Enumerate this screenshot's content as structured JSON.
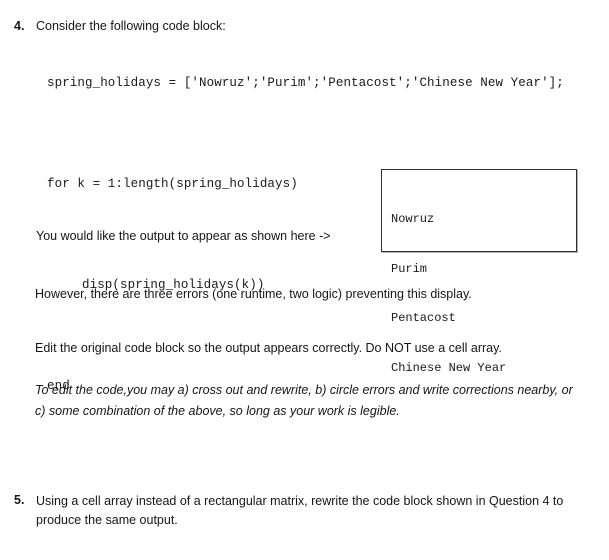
{
  "document": {
    "type": "homework-worksheet",
    "background_color": "#ffffff",
    "text_color": "#161616"
  },
  "question4": {
    "number": "4.",
    "prompt": "Consider the following code block:",
    "code_lines": [
      "spring_holidays = ['Nowruz';'Purim';'Pentacost';'Chinese New Year'];",
      "for k = 1:length(spring_holidays)",
      "disp(spring_holidays(k))",
      "end"
    ],
    "caption": "You would like the output to appear as shown here ->",
    "errors_note": "However, there are three errors (one runtime, two logic) preventing this display.",
    "edit_instruction": "Edit the original code block so the output appears correctly.  Do NOT use a cell array.",
    "edit_methods": "To edit the code,you may a) cross out and rewrite, b) circle errors and write corrections nearby, or c) some combination of the above, so long as your work is legible."
  },
  "output_box": {
    "border_color": "#2e2e2e",
    "lines": [
      "Nowruz",
      "Purim",
      "Pentacost",
      "Chinese New Year"
    ]
  },
  "question5": {
    "number": "5.",
    "text": "Using a cell array instead of a rectangular matrix, rewrite the code block shown in Question 4 to produce the same output."
  }
}
